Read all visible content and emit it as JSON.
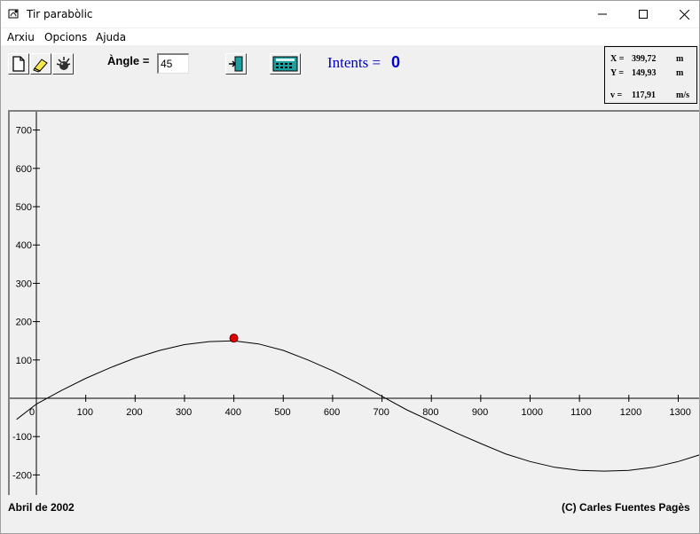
{
  "window": {
    "title": "Tir parabòlic",
    "menu": [
      "Arxiu",
      "Opcions",
      "Ajuda"
    ]
  },
  "toolbar": {
    "angle_label": "Àngle =",
    "angle_value": "45",
    "intents_label": "Intents =",
    "intents_value": "0",
    "buttons": [
      "new-document-icon",
      "eraser-icon",
      "fire-icon",
      "exit-door-icon",
      "calculator-icon"
    ]
  },
  "readout": {
    "x_label": "X =",
    "x_value": "399,72",
    "x_unit": "m",
    "y_label": "Y =",
    "y_value": "149,93",
    "y_unit": "m",
    "v_label": "v =",
    "v_value": "117,91",
    "v_unit": "m/s"
  },
  "status": {
    "left": "Abril de 2002",
    "right": "(C) Carles Fuentes Pagès"
  },
  "colors": {
    "ball": "#e00000",
    "intents": "#0000cc"
  },
  "chart_data": {
    "type": "line",
    "xlim": [
      -40,
      1350
    ],
    "ylim": [
      -250,
      740
    ],
    "x_ticks": [
      0,
      100,
      200,
      300,
      400,
      500,
      600,
      700,
      800,
      900,
      1000,
      1100,
      1200,
      1300
    ],
    "y_ticks": [
      -200,
      -100,
      100,
      200,
      300,
      400,
      500,
      600,
      700
    ],
    "series": [
      {
        "x": [
          -40,
          0,
          50,
          100,
          150,
          200,
          250,
          300,
          350,
          400,
          450,
          500,
          550,
          600,
          650,
          700,
          750,
          800,
          850,
          900,
          950,
          1000,
          1050,
          1100,
          1150,
          1200,
          1250,
          1300,
          1350
        ],
        "y": [
          -55,
          -15,
          20,
          52,
          80,
          105,
          125,
          140,
          148,
          150,
          142,
          125,
          100,
          72,
          40,
          5,
          -30,
          -60,
          -90,
          -118,
          -145,
          -165,
          -180,
          -188,
          -190,
          -188,
          -180,
          -165,
          -145
        ]
      }
    ],
    "marker": {
      "x": 400,
      "y": 157
    }
  }
}
